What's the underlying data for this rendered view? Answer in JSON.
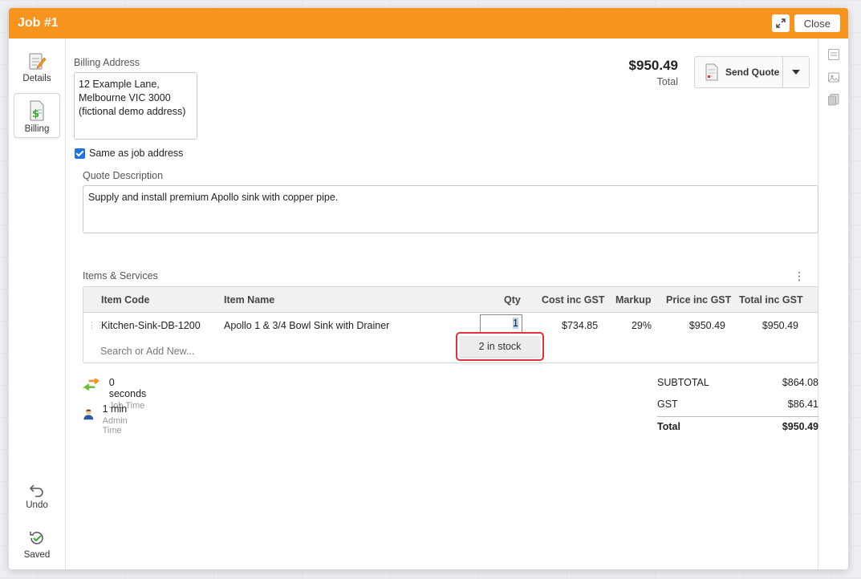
{
  "window": {
    "title": "Job #1",
    "close_label": "Close"
  },
  "nav": {
    "details_label": "Details",
    "billing_label": "Billing",
    "undo_label": "Undo",
    "saved_label": "Saved"
  },
  "billing": {
    "address_label": "Billing Address",
    "address_lines": [
      "12 Example Lane,",
      "Melbourne VIC 3000",
      "(fictional demo address)"
    ],
    "same_as_job_label": "Same as job address",
    "same_as_job_checked": true
  },
  "quote": {
    "total_amount": "$950.49",
    "total_label": "Total",
    "send_label": "Send Quote",
    "description_label": "Quote Description",
    "description": "Supply and install premium Apollo sink with copper pipe."
  },
  "items": {
    "section_label": "Items & Services",
    "columns": [
      "Item Code",
      "Item Name",
      "Qty",
      "Cost inc GST",
      "Markup",
      "Price inc GST",
      "Total inc GST"
    ],
    "rows": [
      {
        "code": "Kitchen-Sink-DB-1200",
        "name": "Apollo 1 & 3/4 Bowl Sink with Drainer",
        "qty": "1",
        "cost": "$734.85",
        "markup": "29%",
        "price": "$950.49",
        "total": "$950.49"
      }
    ],
    "search_placeholder": "Search or Add New...",
    "stock_popup": "2 in stock"
  },
  "time": {
    "job_time_value": "0 seconds",
    "job_time_label": "Job Time",
    "admin_time_value": "1 min",
    "admin_time_label": "Admin Time"
  },
  "summary": {
    "subtotal_label": "SUBTOTAL",
    "subtotal": "$864.08",
    "gst_label": "GST",
    "gst": "$86.41",
    "total_label": "Total",
    "total": "$950.49"
  },
  "colors": {
    "header": "#f7941d",
    "highlight_border": "#e0323a",
    "checkbox": "#1a73e8"
  }
}
